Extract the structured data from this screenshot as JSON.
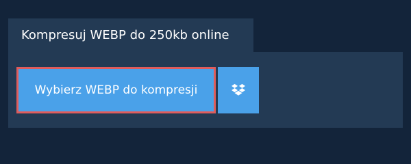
{
  "tab": {
    "title": "Kompresuj WEBP do 250kb online"
  },
  "upload": {
    "button_label": "Wybierz WEBP do kompresji"
  },
  "dropbox": {
    "icon": "dropbox-icon"
  },
  "colors": {
    "background": "#13243a",
    "panel": "#233a54",
    "button": "#4aa1e9",
    "highlight_border": "#e05c5c"
  }
}
